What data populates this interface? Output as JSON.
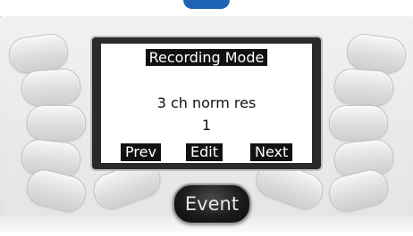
{
  "screen": {
    "title": "Recording Mode",
    "line1": "3 ch norm res",
    "line2": "1",
    "softkeys": {
      "prev": "Prev",
      "edit": "Edit",
      "next": "Next"
    }
  },
  "event_button": {
    "label": "Event"
  },
  "colors": {
    "device_body": "#ebebeb",
    "screen_bg": "#ffffff",
    "screen_text": "#111111",
    "event_button": "#1c1c1c",
    "top_accent": "#1f63b6"
  }
}
